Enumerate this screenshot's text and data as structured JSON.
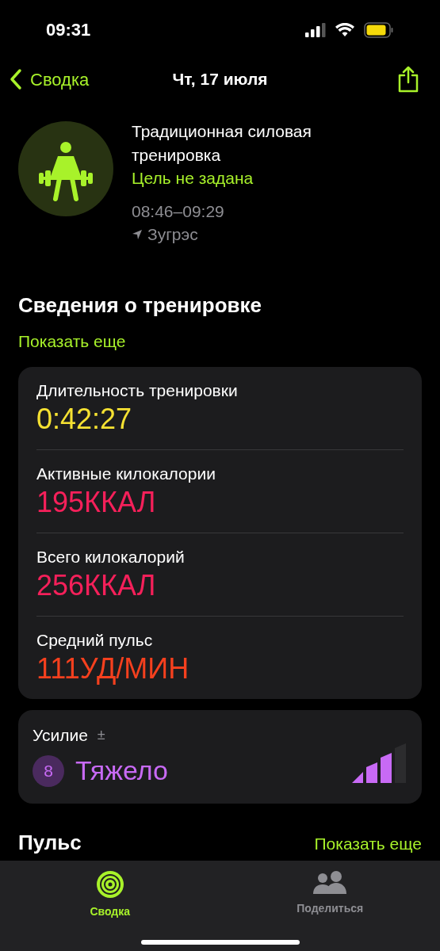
{
  "status_bar": {
    "time": "09:31"
  },
  "nav": {
    "back": "Сводка",
    "title": "Чт, 17 июля"
  },
  "workout": {
    "name": "Традиционная силовая тренировка",
    "goal": "Цель не задана",
    "time": "08:46–09:29",
    "location": "Зугрэс"
  },
  "details": {
    "title": "Сведения о тренировке",
    "more": "Показать еще",
    "metrics": [
      {
        "label": "Длительность тренировки",
        "value": "0:42:27",
        "color": "#f5e132"
      },
      {
        "label": "Активные килокалории",
        "value": "195ККАЛ",
        "color": "#f5205a"
      },
      {
        "label": "Всего килокалорий",
        "value": "256ККАЛ",
        "color": "#f5205a"
      },
      {
        "label": "Средний пульс",
        "value": "111УД/МИН",
        "color": "#f5401e"
      }
    ]
  },
  "effort": {
    "label": "Усилие",
    "adjust": "±",
    "score": "8",
    "value": "Тяжело",
    "level": 0.75
  },
  "pulse": {
    "title": "Пульс",
    "more": "Показать еще"
  },
  "tabs": [
    {
      "label": "Сводка",
      "kind": "rings",
      "selected": true
    },
    {
      "label": "Поделиться",
      "kind": "people",
      "selected": false
    }
  ]
}
